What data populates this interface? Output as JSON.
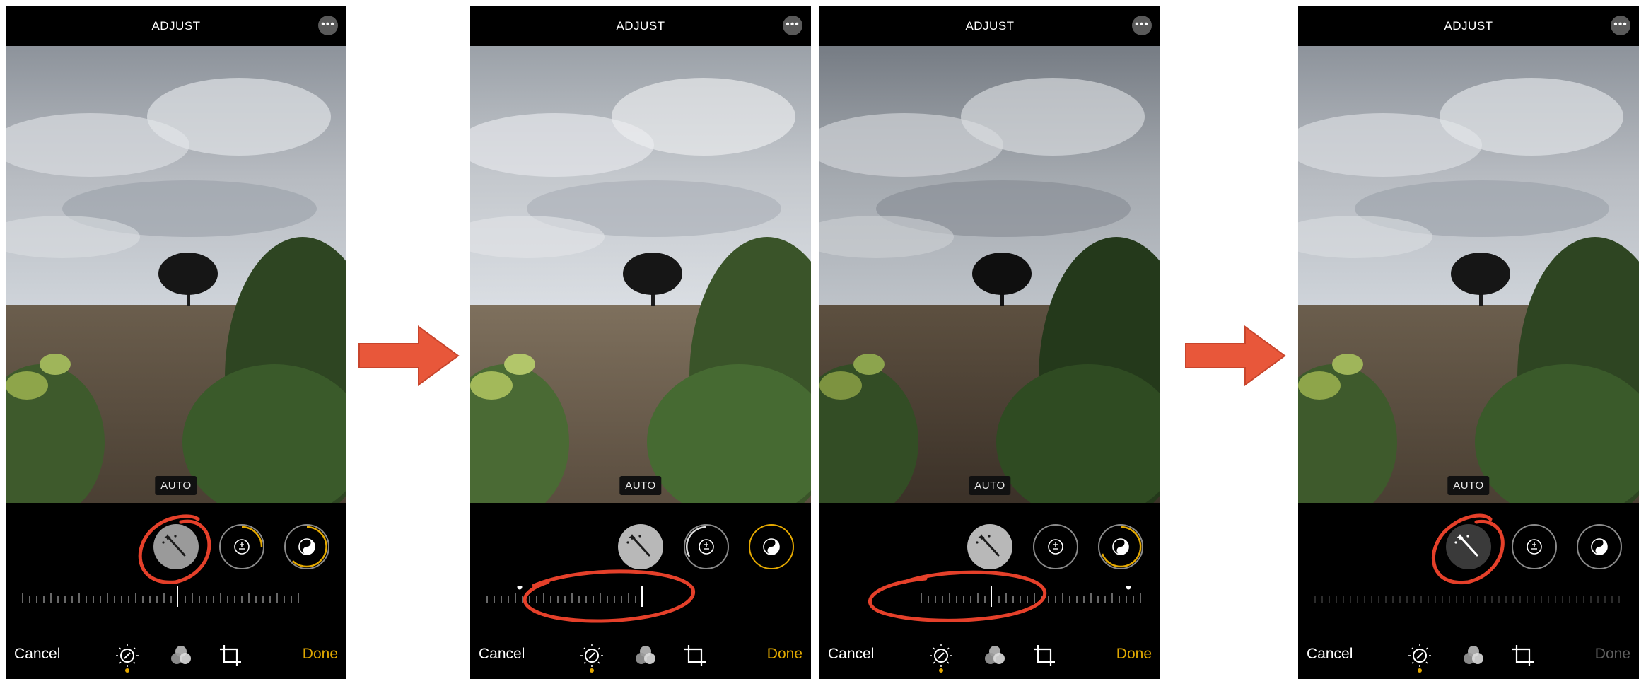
{
  "panels": [
    {
      "title": "ADJUST",
      "auto_label": "AUTO",
      "cancel": "Cancel",
      "done": "Done",
      "auto_state": "selected-unadjusted",
      "slider_value": 0.0
    },
    {
      "title": "ADJUST",
      "auto_label": "AUTO",
      "cancel": "Cancel",
      "done": "Done",
      "auto_state": "active",
      "slider_value": -0.5
    },
    {
      "title": "ADJUST",
      "auto_label": "AUTO",
      "cancel": "Cancel",
      "done": "Done",
      "auto_state": "active",
      "slider_value": 0.5
    },
    {
      "title": "ADJUST",
      "auto_label": "AUTO",
      "cancel": "Cancel",
      "done": "Done",
      "auto_state": "selected-unadjusted",
      "slider_value": 0.0
    }
  ],
  "icons": {
    "more": "more-icon",
    "auto": "magic-wand-icon",
    "exposure": "exposure-icon",
    "brilliance": "brilliance-icon",
    "adjust_tab": "adjust-dial-icon",
    "filters_tab": "filters-icon",
    "crop_tab": "crop-icon"
  },
  "colors": {
    "done_active": "#e0a800",
    "done_inactive": "#5f5f5f",
    "annotation": "#e5402a",
    "arrow": "#e8573a",
    "accent_ring": "#e5a900"
  }
}
